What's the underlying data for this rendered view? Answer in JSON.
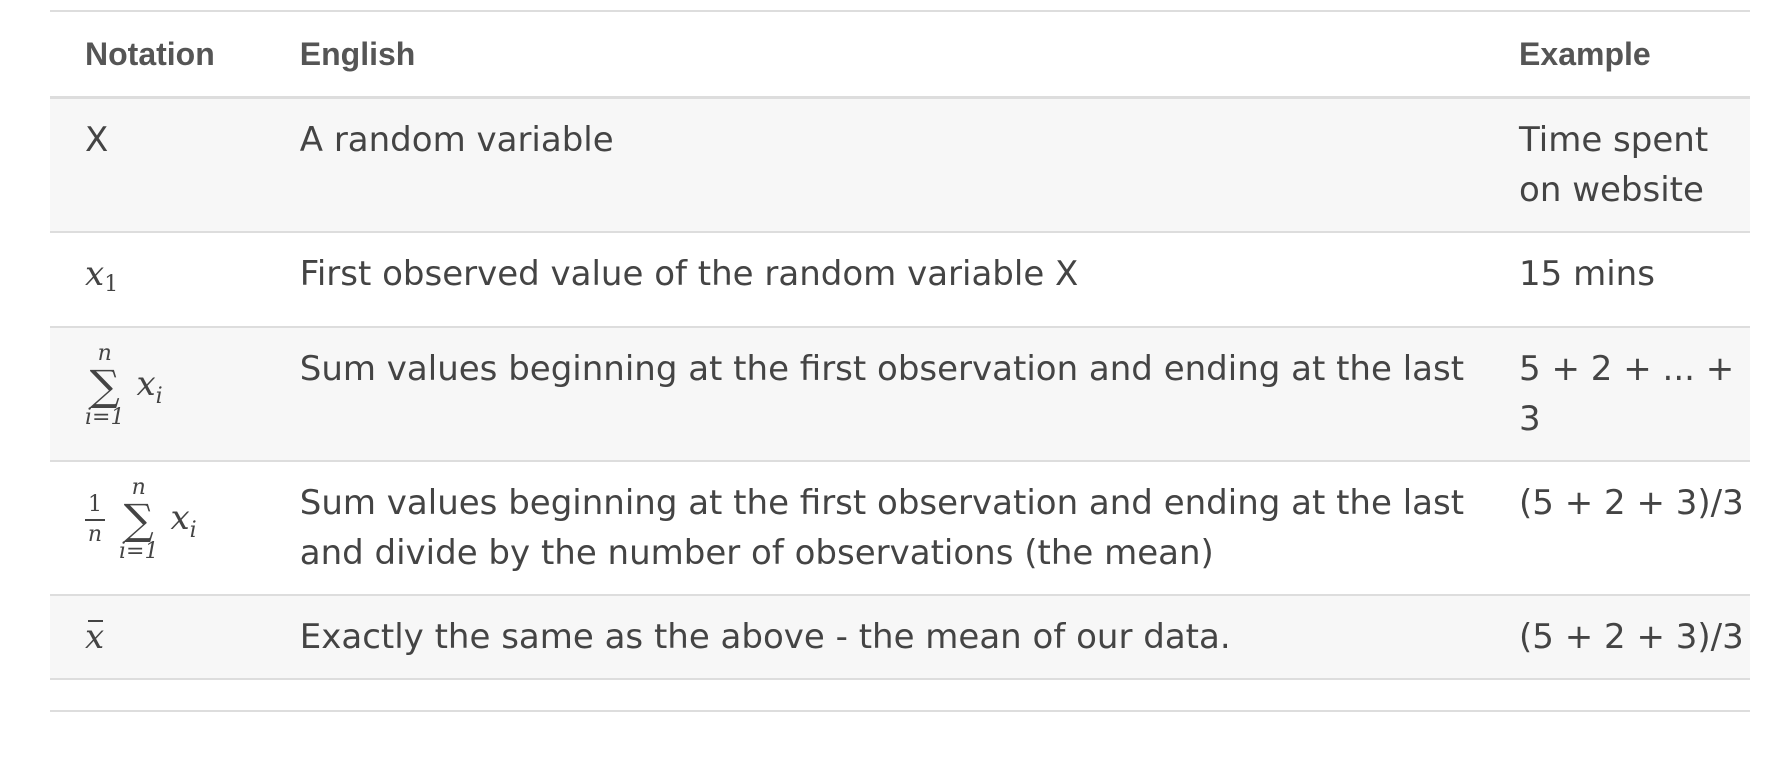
{
  "table": {
    "headers": {
      "notation": "Notation",
      "english": "English",
      "example": "Example"
    },
    "rows": [
      {
        "notation": "X",
        "english": "A random variable",
        "example": "Time spent on website"
      },
      {
        "notation": "x₁",
        "english": "First observed value of the random variable X",
        "example": "15 mins"
      },
      {
        "notation": "∑ᵢ₌₁ⁿ xᵢ",
        "english": "Sum values beginning at the first observation and ending at the last",
        "example": "5 + 2 + ... + 3"
      },
      {
        "notation": "(1/n) ∑ᵢ₌₁ⁿ xᵢ",
        "english": "Sum values beginning at the first observation and ending at the last and divide by the number of observations (the mean)",
        "example": "(5 + 2 + 3)/3"
      },
      {
        "notation": "x̄",
        "english": "Exactly the same as the above - the mean of our data.",
        "example": "(5 + 2 + 3)/3"
      }
    ]
  },
  "math": {
    "x": "x",
    "one": "1",
    "i": "i",
    "n": "n",
    "i_eq_1": "i=1",
    "sigma": "∑"
  }
}
